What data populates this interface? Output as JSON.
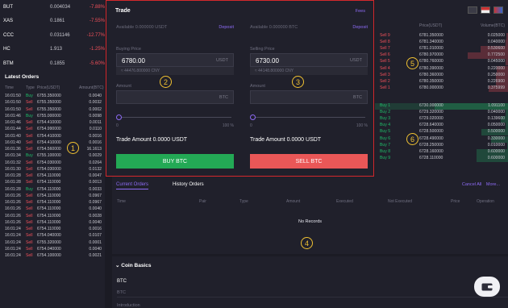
{
  "ticker": [
    {
      "pair": "BUT",
      "price": "0.004034",
      "change": "-7.88%"
    },
    {
      "pair": "XAS",
      "price": "0.1861",
      "change": "-7.55%"
    },
    {
      "pair": "CCC",
      "price": "0.031146",
      "change": "-12.77%"
    },
    {
      "pair": "HC",
      "price": "1.913",
      "change": "-1.25%"
    },
    {
      "pair": "BTM",
      "price": "0.1855",
      "change": "-5.60%"
    }
  ],
  "latest": {
    "title": "Latest Orders",
    "headers": {
      "time": "Time",
      "type": "Type",
      "price": "Price(USDT)",
      "amount": "Amount(BTC)"
    },
    "rows": [
      {
        "time": "16:01:50",
        "type": "Buy",
        "price": "6755.350000",
        "amount": "0.0040"
      },
      {
        "time": "16:01:50",
        "type": "Sell",
        "price": "6755.350000",
        "amount": "0.0032"
      },
      {
        "time": "16:01:50",
        "type": "Sell",
        "price": "6755.350000",
        "amount": "0.0002"
      },
      {
        "time": "16:01:46",
        "type": "Buy",
        "price": "6755.000000",
        "amount": "0.0098"
      },
      {
        "time": "16:01:46",
        "type": "Sell",
        "price": "6754.410000",
        "amount": "0.0011"
      },
      {
        "time": "16:01:44",
        "type": "Sell",
        "price": "6754.990000",
        "amount": "0.0110"
      },
      {
        "time": "16:01:40",
        "type": "Sell",
        "price": "6754.410000",
        "amount": "0.0016"
      },
      {
        "time": "16:01:40",
        "type": "Sell",
        "price": "6754.410000",
        "amount": "0.0016"
      },
      {
        "time": "16:01:36",
        "type": "Sell",
        "price": "6754.560000",
        "amount": "16.1613"
      },
      {
        "time": "16:01:34",
        "type": "Buy",
        "price": "6755.100000",
        "amount": "0.0029"
      },
      {
        "time": "16:01:32",
        "type": "Sell",
        "price": "6754.030000",
        "amount": "0.0264"
      },
      {
        "time": "16:01:30",
        "type": "Sell",
        "price": "6754.030000",
        "amount": "0.0132"
      },
      {
        "time": "16:01:28",
        "type": "Sell",
        "price": "6754.110000",
        "amount": "0.0047"
      },
      {
        "time": "16:01:28",
        "type": "Sell",
        "price": "6754.110000",
        "amount": "0.0013"
      },
      {
        "time": "16:01:28",
        "type": "Buy",
        "price": "6754.110000",
        "amount": "0.0033"
      },
      {
        "time": "16:01:26",
        "type": "Sell",
        "price": "6754.110000",
        "amount": "0.0967"
      },
      {
        "time": "16:01:26",
        "type": "Sell",
        "price": "6754.110000",
        "amount": "0.0967"
      },
      {
        "time": "16:01:26",
        "type": "Sell",
        "price": "6754.110000",
        "amount": "0.0040"
      },
      {
        "time": "16:01:26",
        "type": "Sell",
        "price": "6754.110000",
        "amount": "0.0028"
      },
      {
        "time": "16:01:26",
        "type": "Sell",
        "price": "6754.110000",
        "amount": "0.0040"
      },
      {
        "time": "16:01:24",
        "type": "Sell",
        "price": "6754.110000",
        "amount": "0.0016"
      },
      {
        "time": "16:01:24",
        "type": "Sell",
        "price": "6754.040000",
        "amount": "0.0107"
      },
      {
        "time": "16:01:24",
        "type": "Sell",
        "price": "6755.320000",
        "amount": "0.0001"
      },
      {
        "time": "16:01:24",
        "type": "Sell",
        "price": "6754.040000",
        "amount": "0.0040"
      },
      {
        "time": "16:01:24",
        "type": "Sell",
        "price": "6754.100000",
        "amount": "0.0021"
      }
    ]
  },
  "trade": {
    "title": "Trade",
    "fees": "Fees",
    "buy": {
      "avail": "Available 0.000000 USDT",
      "deposit": "Deposit",
      "price_label": "Buying Price",
      "price": "6780.00",
      "price_unit": "USDT",
      "cny": "≈ 44476.800000 CNY",
      "amount_label": "Amount",
      "amount_unit": "BTC",
      "pct_min": "0",
      "pct_max": "100 %",
      "total": "Trade Amount 0.0000 USDT",
      "button": "BUY BTC"
    },
    "sell": {
      "avail": "Available 0.000000 BTC",
      "deposit": "Deposit",
      "price_label": "Selling Price",
      "price": "6730.00",
      "price_unit": "USDT",
      "cny": "≈ 44148.800000 CNY",
      "amount_label": "Amount",
      "amount_unit": "BTC",
      "pct_min": "0",
      "pct_max": "100 %",
      "total": "Trade Amount 0.0000 USDT",
      "button": "SELL BTC"
    }
  },
  "book": {
    "headers": {
      "price": "Price(USDT)",
      "volume": "Volume(BTC)"
    },
    "sells": [
      {
        "label": "Sell 9",
        "price": "6781.350000",
        "volume": "0.025000",
        "fill": 0.02
      },
      {
        "label": "Sell 8",
        "price": "6781.340000",
        "volume": "0.040000",
        "fill": 0.03
      },
      {
        "label": "Sell 7",
        "price": "6781.010000",
        "volume": "0.530600",
        "fill": 0.38
      },
      {
        "label": "Sell 6",
        "price": "6780.970000",
        "volume": "0.772500",
        "fill": 0.55
      },
      {
        "label": "Sell 5",
        "price": "6780.760000",
        "volume": "0.045000",
        "fill": 0.03
      },
      {
        "label": "Sell 4",
        "price": "6780.390000",
        "volume": "0.220000",
        "fill": 0.15
      },
      {
        "label": "Sell 3",
        "price": "6780.360000",
        "volume": "0.250000",
        "fill": 0.17
      },
      {
        "label": "Sell 2",
        "price": "6780.350000",
        "volume": "0.226900",
        "fill": 0.16
      },
      {
        "label": "Sell 1",
        "price": "6780.000000",
        "volume": "0.375999",
        "fill": 0.26
      }
    ],
    "buys": [
      {
        "label": "Buy 1",
        "price": "6730.000000",
        "volume": "1.091100",
        "fill": 1.0
      },
      {
        "label": "Buy 2",
        "price": "6729.320000",
        "volume": "0.040000",
        "fill": 0.03
      },
      {
        "label": "Buy 3",
        "price": "6729.020000",
        "volume": "0.139600",
        "fill": 0.1
      },
      {
        "label": "Buy 4",
        "price": "6728.640000",
        "volume": "0.050000",
        "fill": 0.03
      },
      {
        "label": "Buy 5",
        "price": "6728.500000",
        "volume": "0.500000",
        "fill": 0.36
      },
      {
        "label": "Buy 6",
        "price": "6728.490000",
        "volume": "0.330000",
        "fill": 0.23
      },
      {
        "label": "Buy 7",
        "price": "6728.250000",
        "volume": "0.010000",
        "fill": 0.01
      },
      {
        "label": "Buy 8",
        "price": "6728.160000",
        "volume": "0.600000",
        "fill": 0.43
      },
      {
        "label": "Buy 9",
        "price": "6728.110000",
        "volume": "0.600000",
        "fill": 0.43
      }
    ]
  },
  "orders": {
    "tabs": [
      "Current Orders",
      "History Orders"
    ],
    "cancel_all": "Cancel All",
    "more": "More...",
    "headers": [
      "Time",
      "Pair",
      "Type",
      "Amount",
      "Executed",
      "Not Executed",
      "Price",
      "Operation"
    ],
    "empty": "No Records"
  },
  "coin": {
    "title": "Coin Basics",
    "name": "BTC",
    "sub": "BTC",
    "intro": "Introduction"
  },
  "markers": [
    "1",
    "2",
    "3",
    "4",
    "5",
    "6"
  ],
  "colors": {
    "buy": "#1fbf6a",
    "sell": "#f0505a",
    "accent": "#8d6bf5",
    "marker": "#f1c232"
  }
}
